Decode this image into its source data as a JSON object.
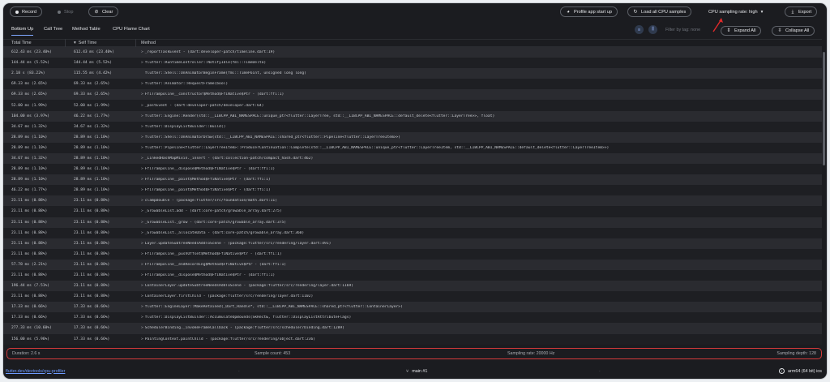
{
  "toolbar": {
    "record_label": "Record",
    "stop_label": "Stop",
    "clear_label": "Clear",
    "profile_startup_label": "Profile app start up",
    "load_samples_label": "Load all CPU samples",
    "sampling_rate_label": "CPU sampling rate: high",
    "export_label": "Export"
  },
  "tabs": [
    {
      "label": "Bottom Up",
      "active": true
    },
    {
      "label": "Call Tree",
      "active": false
    },
    {
      "label": "Method Table",
      "active": false
    },
    {
      "label": "CPU Flame Chart",
      "active": false
    }
  ],
  "filter": {
    "placeholder": "Filter by tag: none",
    "expand_all_label": "Expand All",
    "collapse_all_label": "Collapse All"
  },
  "table": {
    "headers": [
      "Total Time",
      "Self Time",
      "Method"
    ],
    "rows": [
      {
        "total": "612.43 ms (23.40%)",
        "self": "612.43 ms (23.40%)",
        "method": "_reportTaskEvent - (dart:developer-patch/timeline.dart:19)",
        "expandable": true
      },
      {
        "total": "144.44 ms (5.52%)",
        "self": "144.44 ms (5.52%)",
        "method": "flutter::RuntimeController::NotifyIdle(fml::TimeDelta)",
        "expandable": true
      },
      {
        "total": "2.18 s (83.22%)",
        "self": "115.55 ms (4.42%)",
        "method": "flutter::Shell::OnAnimatorBeginFrame(fml::TimePoint, unsigned long long)",
        "expandable": false
      },
      {
        "total": "69.33 ms (2.65%)",
        "self": "69.33 ms (2.65%)",
        "method": "flutter::Animator::RequestFrame(bool)",
        "expandable": true
      },
      {
        "total": "69.33 ms (2.65%)",
        "self": "69.33 ms (2.65%)",
        "method": "FfiTrampoline__constructor$Method$FfiNative$Ptr - (dart:ffi:1)",
        "expandable": true
      },
      {
        "total": "52.00 ms (1.99%)",
        "self": "52.00 ms (1.99%)",
        "method": "_postEvent - (dart:developer-patch/developer.dart:64)",
        "expandable": true
      },
      {
        "total": "104.00 ms (3.97%)",
        "self": "46.22 ms (1.77%)",
        "method": "flutter::Engine::Render(std::__LIBCPP_ABI_NAMESPACE::unique_ptr<flutter::LayerTree, std::__LIBCPP_ABI_NAMESPACE::default_delete<flutter::LayerTree>>, float)",
        "expandable": true
      },
      {
        "total": "34.67 ms (1.32%)",
        "self": "34.67 ms (1.32%)",
        "method": "flutter::DisplayListBuilder::Build()",
        "expandable": true
      },
      {
        "total": "28.89 ms (1.10%)",
        "self": "28.89 ms (1.10%)",
        "method": "flutter::Shell::OnAnimatorDraw(std::__LIBCPP_ABI_NAMESPACE::shared_ptr<flutter::Pipeline<flutter::LayerTreeItem>>)",
        "expandable": true
      },
      {
        "total": "28.89 ms (1.10%)",
        "self": "28.89 ms (1.10%)",
        "method": "flutter::Pipeline<flutter::LayerTreeItem>::ProducerContinuation::Complete(std::__LIBCPP_ABI_NAMESPACE::unique_ptr<flutter::LayerTreeItem, std::__LIBCPP_ABI_NAMESPACE::default_delete<flutter::LayerTreeItem>>)",
        "expandable": true
      },
      {
        "total": "34.67 ms (1.32%)",
        "self": "28.89 ms (1.10%)",
        "method": "_LinkedHashMapMixin._insert - (dart:collection-patch/compact_hash.dart:462)",
        "expandable": true
      },
      {
        "total": "28.89 ms (1.10%)",
        "self": "28.89 ms (1.10%)",
        "method": "FfiTrampoline__dispose$Method$FfiNative$Ptr - (dart:ffi:1)",
        "expandable": true
      },
      {
        "total": "28.89 ms (1.10%)",
        "self": "28.89 ms (1.10%)",
        "method": "FfiTrampoline__paint$Method$FfiNative$Ptr - (dart:ffi:1)",
        "expandable": true
      },
      {
        "total": "46.22 ms (1.77%)",
        "self": "28.89 ms (1.10%)",
        "method": "FfiTrampoline__paint$Method$FfiNative$Ptr - (dart:ffi:1)",
        "expandable": true
      },
      {
        "total": "23.11 ms (0.88%)",
        "self": "23.11 ms (0.88%)",
        "method": "clampDouble - (package:flutter/src/foundation/math.dart:11)",
        "expandable": true
      },
      {
        "total": "23.11 ms (0.88%)",
        "self": "23.11 ms (0.88%)",
        "method": "_GrowableList.add - (dart:core-patch/growable_array.dart:275)",
        "expandable": true
      },
      {
        "total": "23.11 ms (0.88%)",
        "self": "23.11 ms (0.88%)",
        "method": "_GrowableList._grow - (dart:core-patch/growable_array.dart:375)",
        "expandable": true
      },
      {
        "total": "23.11 ms (0.88%)",
        "self": "23.11 ms (0.88%)",
        "method": "_GrowableList._allocateData - (dart:core-patch/growable_array.dart:360)",
        "expandable": true
      },
      {
        "total": "23.11 ms (0.88%)",
        "self": "23.11 ms (0.88%)",
        "method": "Layer.updateSubtreeNeedsAddToScene - (package:flutter/src/rendering/layer.dart:491)",
        "expandable": true
      },
      {
        "total": "23.11 ms (0.88%)",
        "self": "23.11 ms (0.88%)",
        "method": "FfiTrampoline__pushOffset$Method$FfiNative$Ptr - (dart:ffi:1)",
        "expandable": true
      },
      {
        "total": "57.78 ms (2.21%)",
        "self": "23.11 ms (0.88%)",
        "method": "FfiTrampoline__endRecording$Method$FfiNative$Ptr - (dart:ffi:1)",
        "expandable": true
      },
      {
        "total": "23.11 ms (0.88%)",
        "self": "23.11 ms (0.88%)",
        "method": "FfiTrampoline__dispose$Method$FfiNative$Ptr - (dart:ffi:1)",
        "expandable": true
      },
      {
        "total": "196.44 ms (7.51%)",
        "self": "23.11 ms (0.88%)",
        "method": "ContainerLayer.updateSubtreeNeedsAddToScene - (package:flutter/src/rendering/layer.dart:1169)",
        "expandable": true
      },
      {
        "total": "23.11 ms (0.88%)",
        "self": "23.11 ms (0.88%)",
        "method": "ContainerLayer.firstChild - (package:flutter/src/rendering/layer.dart:1102)",
        "expandable": true
      },
      {
        "total": "17.33 ms (0.66%)",
        "self": "17.33 ms (0.66%)",
        "method": "flutter::EngineLayer::MakeRetained(_Dart_Handle*, std::__LIBCPP_ABI_NAMESPACE::shared_ptr<flutter::ContainerLayer>)",
        "expandable": true
      },
      {
        "total": "17.33 ms (0.66%)",
        "self": "17.33 ms (0.66%)",
        "method": "flutter::DisplayListBuilder::AccumulateOpBounds(SkRect&, flutter::DisplayListAttributeFlags)",
        "expandable": true
      },
      {
        "total": "277.33 ms (10.60%)",
        "self": "17.33 ms (0.66%)",
        "method": "SchedulerBinding._invokeFrameCallback - (package:flutter/src/scheduler/binding.dart:1289)",
        "expandable": true
      },
      {
        "total": "156.00 ms (5.96%)",
        "self": "17.33 ms (0.66%)",
        "method": "PaintingContext.paintChild - (package:flutter/src/rendering/object.dart:236)",
        "expandable": true
      }
    ]
  },
  "summary": {
    "duration": "Duration: 2.6 s",
    "sample_count": "Sample count: 453",
    "sampling_rate": "Sampling rate: 20000 Hz",
    "sampling_depth": "Sampling depth: 128"
  },
  "status": {
    "link": "flutter.dev/devtools/cpu-profiler",
    "sep1": "·",
    "sep2": "·",
    "branch": "main #1",
    "arch": "arm64 (64 bit) ios"
  },
  "colors": {
    "accent": "#7fa8ff",
    "summary_border": "#d23a3a",
    "background": "#1b1c20"
  }
}
